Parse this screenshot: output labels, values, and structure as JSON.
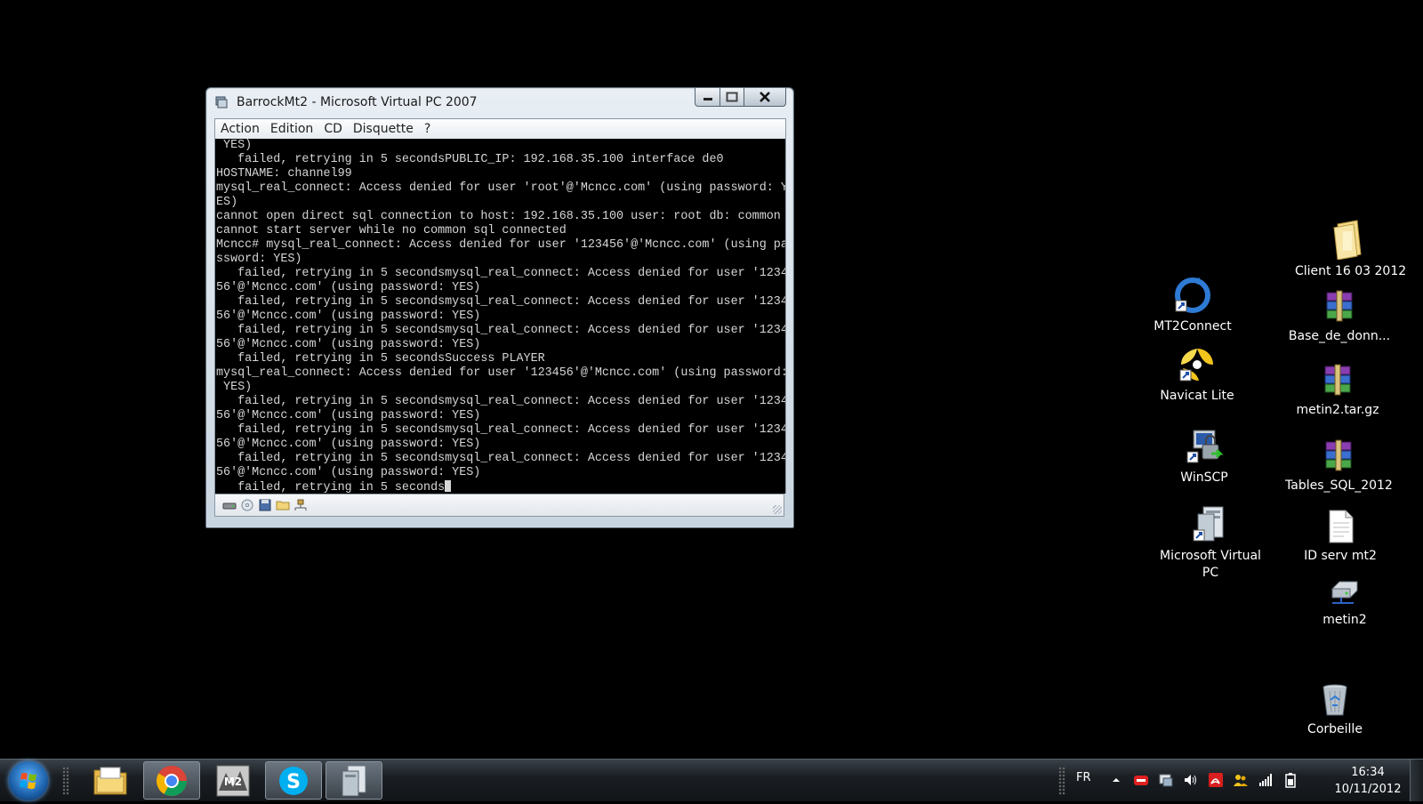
{
  "window": {
    "title": "BarrockMt2 - Microsoft Virtual PC 2007",
    "menu": [
      "Action",
      "Edition",
      "CD",
      "Disquette",
      "?"
    ],
    "terminal_lines": [
      " YES)",
      "   failed, retrying in 5 secondsPUBLIC_IP: 192.168.35.100 interface de0",
      "HOSTNAME: channel99",
      "mysql_real_connect: Access denied for user 'root'@'Mcncc.com' (using password: Y",
      "ES)",
      "cannot open direct sql connection to host: 192.168.35.100 user: root db: common",
      "cannot start server while no common sql connected",
      "Mcncc# mysql_real_connect: Access denied for user '123456'@'Mcncc.com' (using pa",
      "ssword: YES)",
      "   failed, retrying in 5 secondsmysql_real_connect: Access denied for user '1234",
      "56'@'Mcncc.com' (using password: YES)",
      "   failed, retrying in 5 secondsmysql_real_connect: Access denied for user '1234",
      "56'@'Mcncc.com' (using password: YES)",
      "   failed, retrying in 5 secondsmysql_real_connect: Access denied for user '1234",
      "56'@'Mcncc.com' (using password: YES)",
      "   failed, retrying in 5 secondsSuccess PLAYER",
      "mysql_real_connect: Access denied for user '123456'@'Mcncc.com' (using password:",
      " YES)",
      "   failed, retrying in 5 secondsmysql_real_connect: Access denied for user '1234",
      "56'@'Mcncc.com' (using password: YES)",
      "   failed, retrying in 5 secondsmysql_real_connect: Access denied for user '1234",
      "56'@'Mcncc.com' (using password: YES)",
      "   failed, retrying in 5 secondsmysql_real_connect: Access denied for user '1234",
      "56'@'Mcncc.com' (using password: YES)",
      "   failed, retrying in 5 seconds"
    ],
    "status_icons": [
      "hard-disk-icon",
      "cd-icon",
      "floppy-icon",
      "shared-folder-icon",
      "network-icon"
    ]
  },
  "desktop_icons": [
    {
      "label": "Client 16 03 2012",
      "icon": "folder-icon"
    },
    {
      "label": "MT2Connect",
      "icon": "mt2connect-icon"
    },
    {
      "label": "Base_de_donn...",
      "icon": "winrar-archive-icon"
    },
    {
      "label": "Navicat Lite",
      "icon": "navicat-icon"
    },
    {
      "label": "metin2.tar.gz",
      "icon": "winrar-archive-icon"
    },
    {
      "label": "WinSCP",
      "icon": "winscp-icon"
    },
    {
      "label": "Tables_SQL_2012",
      "icon": "winrar-archive-icon"
    },
    {
      "label": "Microsoft Virtual PC",
      "icon": "virtual-pc-icon"
    },
    {
      "label": "ID serv mt2",
      "icon": "text-document-icon"
    },
    {
      "label": "metin2",
      "icon": "network-drive-icon"
    },
    {
      "label": "Corbeille",
      "icon": "recycle-bin-icon"
    }
  ],
  "taskbar": {
    "pinned": [
      "explorer-icon",
      "chrome-icon",
      "metin2-game-icon",
      "skype-icon",
      "virtual-pc-icon"
    ],
    "language": "FR",
    "time": "16:34",
    "date": "10/11/2012"
  },
  "colors": {
    "desktop": "#000000",
    "terminal_bg": "#000000",
    "terminal_text": "#d6d6d6",
    "window_frame": "#c9d5e0"
  }
}
